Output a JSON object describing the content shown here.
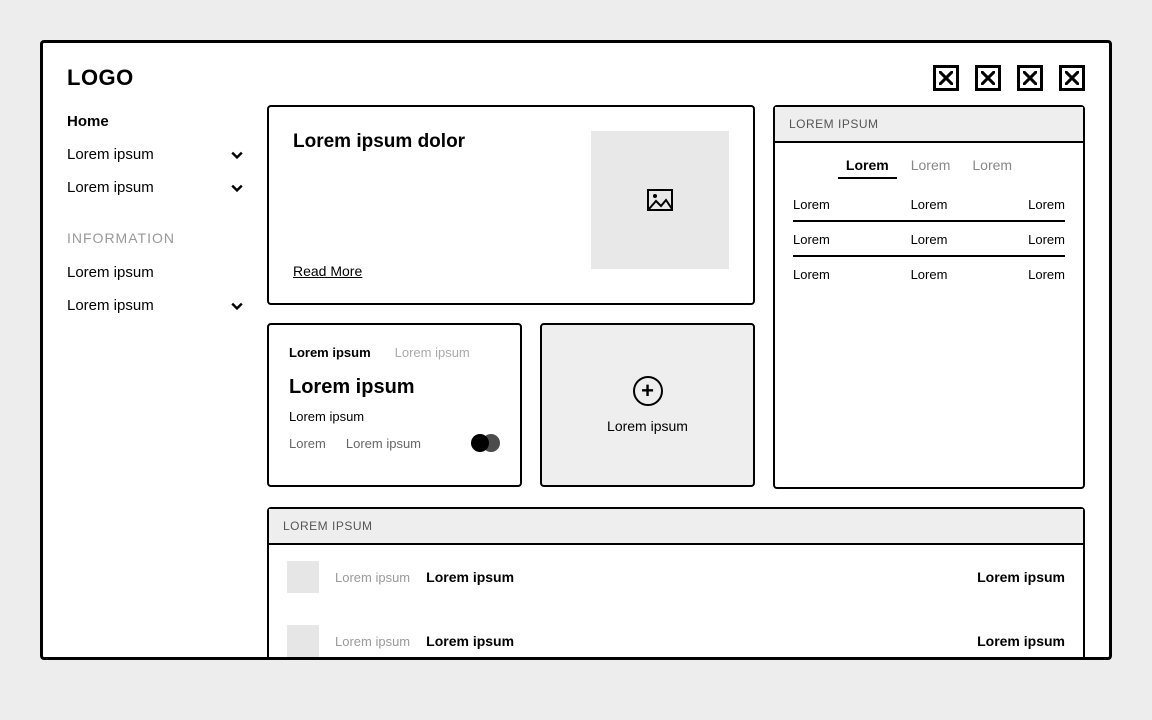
{
  "logo": "LOGO",
  "sidebar": {
    "items": [
      {
        "label": "Home",
        "active": true,
        "expandable": false
      },
      {
        "label": "Lorem ipsum",
        "active": false,
        "expandable": true
      },
      {
        "label": "Lorem ipsum",
        "active": false,
        "expandable": true
      }
    ],
    "section_title": "INFORMATION",
    "section_items": [
      {
        "label": "Lorem ipsum",
        "expandable": false
      },
      {
        "label": "Lorem ipsum",
        "expandable": true
      }
    ]
  },
  "hero": {
    "title": "Lorem ipsum dolor",
    "cta": "Read More"
  },
  "info_card": {
    "tab_active": "Lorem ipsum",
    "tab_inactive": "Lorem ipsum",
    "headline": "Lorem ipsum",
    "subline": "Lorem ipsum",
    "foot1": "Lorem",
    "foot2": "Lorem ipsum"
  },
  "add_card": {
    "label": "Lorem ipsum"
  },
  "right_panel": {
    "header": "LOREM IPSUM",
    "tabs": [
      "Lorem",
      "Lorem",
      "Lorem"
    ],
    "rows": [
      [
        "Lorem",
        "Lorem",
        "Lorem"
      ],
      [
        "Lorem",
        "Lorem",
        "Lorem"
      ],
      [
        "Lorem",
        "Lorem",
        "Lorem"
      ]
    ]
  },
  "bottom_panel": {
    "header": "LOREM IPSUM",
    "rows": [
      {
        "c1": "Lorem ipsum",
        "c2": "Lorem ipsum",
        "c3": "Lorem ipsum"
      },
      {
        "c1": "Lorem ipsum",
        "c2": "Lorem ipsum",
        "c3": "Lorem ipsum"
      }
    ]
  }
}
